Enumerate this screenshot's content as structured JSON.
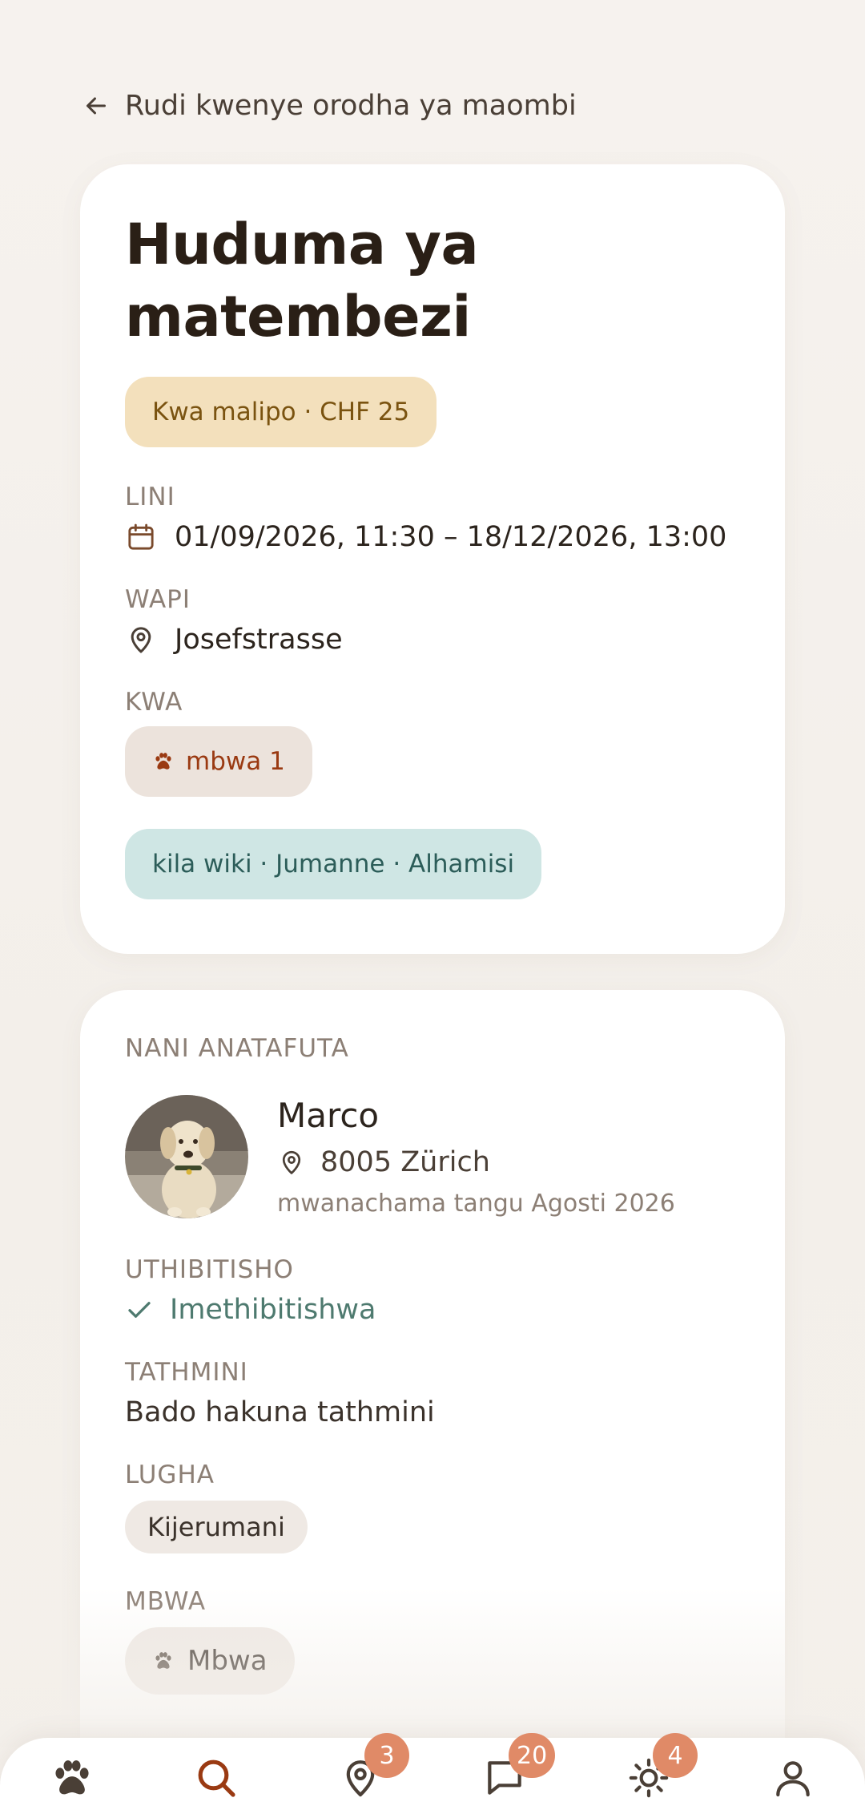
{
  "back": {
    "label": "Rudi kwenye orodha ya maombi"
  },
  "request": {
    "title_line1": "Huduma ya",
    "title_line2": "matembezi",
    "price_pill": "Kwa malipo · CHF 25",
    "when_label": "LINI",
    "when_value": "01/09/2026, 11:30 – 18/12/2026, 13:00",
    "where_label": "WAPI",
    "where_value": "Josefstrasse",
    "for_label": "KWA",
    "dog_pill": "mbwa 1",
    "schedule_pill": "kila wiki · Jumanne · Alhamisi"
  },
  "requester": {
    "section_label": "NANI ANATAFUTA",
    "name": "Marco",
    "location": "8005 Zürich",
    "member_since": "mwanachama tangu Agosti 2026",
    "verification_label": "UTHIBITISHO",
    "verification_value": "Imethibitishwa",
    "ratings_label": "TATHMINI",
    "ratings_value": "Bado hakuna tathmini",
    "language_label": "LUGHA",
    "language_value": "Kijerumani",
    "dogs_label": "MBWA",
    "dogs_value": "Mbwa"
  },
  "nav": {
    "items": [
      {
        "icon": "paw-icon"
      },
      {
        "icon": "search-icon"
      },
      {
        "icon": "map-pin-icon",
        "badge": "3"
      },
      {
        "icon": "chat-icon",
        "badge": "20"
      },
      {
        "icon": "sun-icon",
        "badge": "4"
      },
      {
        "icon": "user-icon"
      }
    ]
  },
  "colors": {
    "accent": "#9a3a12",
    "badge": "#e08a67",
    "verified": "#4e7a6f",
    "price_bg": "#f3e0bc",
    "schedule_bg": "#cfe6e4"
  }
}
